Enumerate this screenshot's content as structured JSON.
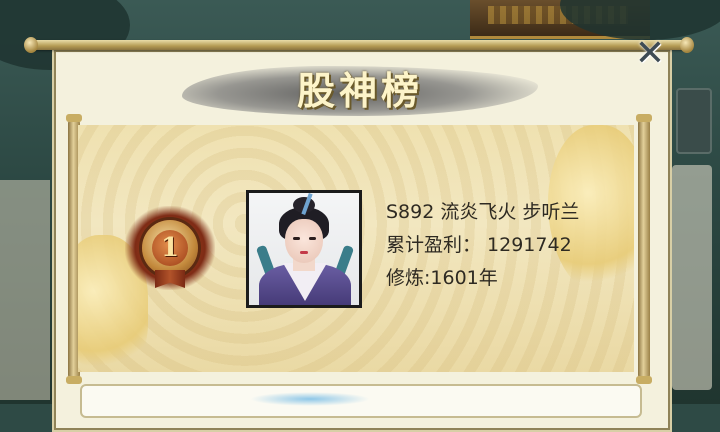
{
  "dialog": {
    "title": "股神榜",
    "close_icon": "close-icon"
  },
  "leaderboard": {
    "entries": [
      {
        "rank": "1",
        "server_and_name": "S892 流炎飞火 步听兰",
        "profit_line": "累计盈利：  1291742",
        "cultivation_line": "修炼:1601年"
      }
    ]
  },
  "colors": {
    "title_text": "#fdf4c9",
    "scroll_paper": "#efe1b0",
    "close_icon": "#3e4b54",
    "rank_badge": "#b45524"
  }
}
